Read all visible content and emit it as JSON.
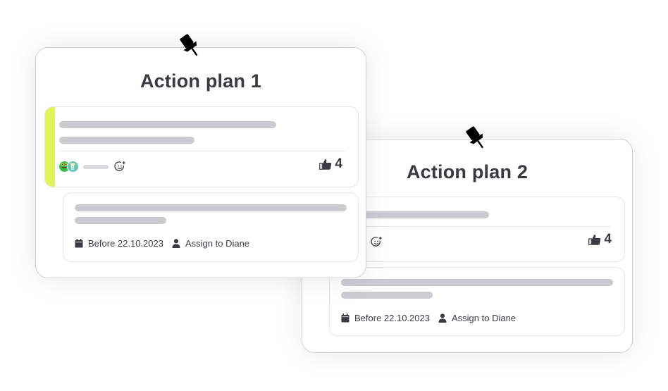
{
  "colors": {
    "accent": "#e1f55a",
    "skeleton": "#cbcbd1",
    "text": "#3a3a40"
  },
  "plans": [
    {
      "title": "Action plan 1",
      "pin_icon": "pushpin-icon",
      "comment": {
        "accent_color": "#e1f55a",
        "avatars": [
          "monster-avatar-green",
          "monster-avatar-teal"
        ],
        "add_reaction_icon": "smiley-plus-icon",
        "like_icon": "thumbs-up-icon",
        "likes": "4"
      },
      "task": {
        "date_icon": "calendar-icon",
        "date_label": "Before 22.10.2023",
        "assignee_icon": "user-icon",
        "assignee_label": "Assign to Diane"
      }
    },
    {
      "title": "Action plan 2",
      "pin_icon": "pushpin-icon",
      "comment": {
        "add_reaction_icon": "smiley-plus-icon",
        "like_icon": "thumbs-up-icon",
        "likes": "4"
      },
      "task": {
        "date_icon": "calendar-icon",
        "date_label": "Before 22.10.2023",
        "assignee_icon": "user-icon",
        "assignee_label": "Assign to Diane"
      }
    }
  ]
}
